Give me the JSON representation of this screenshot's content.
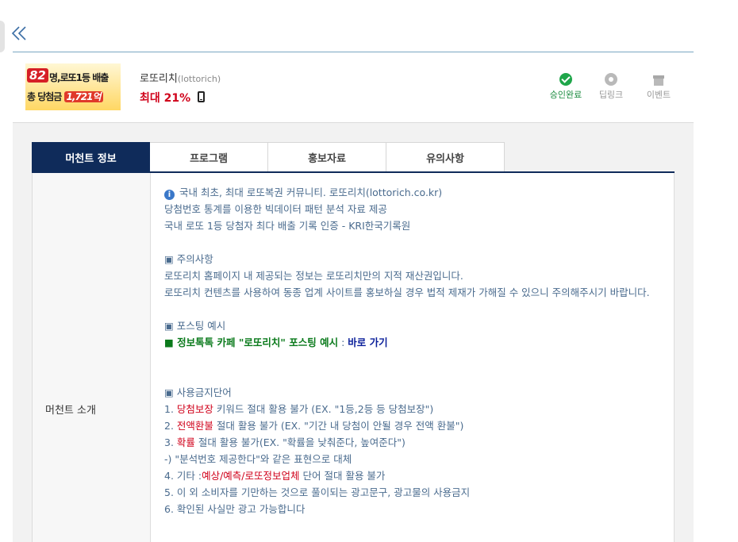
{
  "nav": {
    "back_icon": "double-chevron-left-icon"
  },
  "merchant": {
    "banner": {
      "count": "82",
      "line1": "명,로또1등 배출",
      "line2_prefix": "총 당첨금",
      "line2_amount": "1,721억"
    },
    "name": "로또리치",
    "name_en": "(lottorich)",
    "rate": "최대 21%",
    "device_icon": "mobile-phone-icon"
  },
  "status": {
    "approved": "승인완료",
    "deeplink": "딥링크",
    "event": "이벤트",
    "colors": {
      "approved": "#1fa64a",
      "inactive": "#b9b9b9"
    }
  },
  "tabs": [
    {
      "label": "머천트 정보",
      "active": true
    },
    {
      "label": "프로그램",
      "active": false
    },
    {
      "label": "홍보자료",
      "active": false
    },
    {
      "label": "유의사항",
      "active": false
    }
  ],
  "section": {
    "label": "머천트 소개",
    "intro": [
      "국내 최초, 최대 로또복권 커뮤니티. 로또리치(lottorich.co.kr)",
      "당첨번호 통계를 이용한 빅데이터 패턴 분석 자료 제공",
      "국내 로또 1등 당첨자 최다 배출 기록 인증 - KRI한국기록원"
    ],
    "notice_title": "▣ 주의사항",
    "notice": [
      "로또리치 홈페이지 내 제공되는 정보는 로또리치만의 지적 재산권입니다.",
      "로또리치 컨텐츠를 사용하여 동종 업계 사이트를 홍보하실 경우 법적 제재가 가해질 수 있으니 주의해주시기 바랍니다."
    ],
    "posting_title": "▣ 포스팅 예시",
    "posting_text": "■ 정보톡톡 카페 \"로또리치\" 포스팅 예시",
    "posting_colon": " : ",
    "posting_link": "바로 가기",
    "banned_title": "▣ 사용금지단어",
    "banned": [
      {
        "num": "1. ",
        "word": "당첨보장",
        "rest": " 키워드 절대 활용 불가 (EX. \"1등,2등 등 당첨보장\")"
      },
      {
        "num": "2. ",
        "word": "전액환불",
        "rest": " 절대 활용 불가 (EX. \"기간 내 당첨이 안될 경우 전액 환불\")"
      },
      {
        "num": "3. ",
        "word": "확률",
        "rest": " 절대 활용 불가(EX. \"확률을 낮춰준다, 높여준다\")"
      }
    ],
    "banned_alt": "-) \"분석번호 제공한다\"와 같은 표현으로 대체",
    "banned_4_prefix": "4. 기타 :",
    "banned_4_word": "예상/예측/로또정보업체",
    "banned_4_rest": " 단어 절대 활용 불가",
    "banned_5": "5. 이 외 소비자를 기만하는 것으로 풀이되는 광고문구, 광고물의 사용금지",
    "banned_6": "6. 확인된 사실만 광고 가능합니다"
  }
}
